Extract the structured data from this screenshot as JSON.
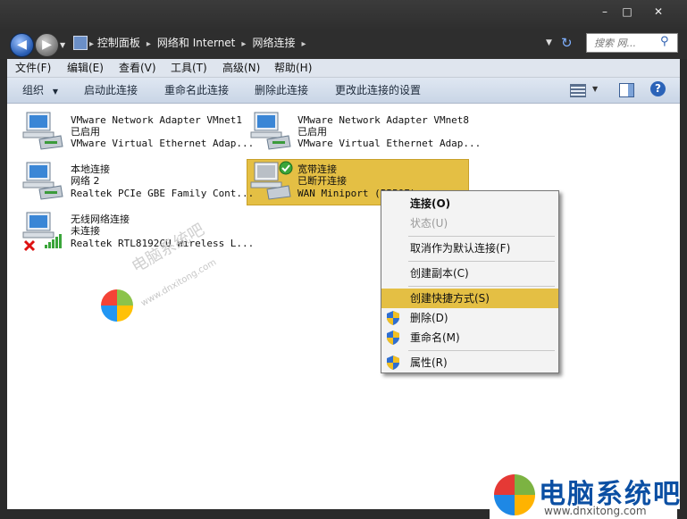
{
  "window": {
    "minimize": "–",
    "maximize": "□",
    "close": "✕"
  },
  "breadcrumb": [
    "控制面板",
    "网络和 Internet",
    "网络连接"
  ],
  "search": {
    "placeholder": "搜索 网..."
  },
  "menu": [
    "文件(F)",
    "编辑(E)",
    "查看(V)",
    "工具(T)",
    "高级(N)",
    "帮助(H)"
  ],
  "toolbar": {
    "organize": "组织",
    "start": "启动此连接",
    "rename": "重命名此连接",
    "delete": "删除此连接",
    "settings": "更改此连接的设置"
  },
  "connections": [
    {
      "title": "VMware Network Adapter VMnet1",
      "status": "已启用",
      "device": "VMware Virtual Ethernet Adap..."
    },
    {
      "title": "VMware Network Adapter VMnet8",
      "status": "已启用",
      "device": "VMware Virtual Ethernet Adap..."
    },
    {
      "title": "本地连接",
      "status": "网络  2",
      "device": "Realtek PCIe GBE Family Cont..."
    },
    {
      "title": "宽带连接",
      "status": "已断开连接",
      "device": "WAN Miniport (PPPOE)"
    },
    {
      "title": "无线网络连接",
      "status": "未连接",
      "device": "Realtek RTL8192CU Wireless L..."
    }
  ],
  "context_menu": {
    "connect": "连接(O)",
    "status": "状态(U)",
    "unset_default": "取消作为默认连接(F)",
    "copy": "创建副本(C)",
    "shortcut": "创建快捷方式(S)",
    "delete": "删除(D)",
    "rename": "重命名(M)",
    "properties": "属性(R)"
  },
  "watermark": {
    "center_text": "电脑系统吧",
    "center_url": "www.dnxitong.com",
    "brand_text": "电脑系统吧",
    "brand_url": "www.dnxitong.com"
  },
  "colors": {
    "selection": "#e4bf44",
    "brand_blue": "#0b4fa3"
  }
}
